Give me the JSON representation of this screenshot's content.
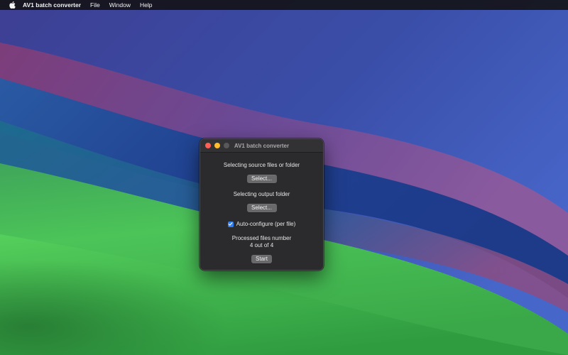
{
  "menubar": {
    "app_name": "AV1 batch converter",
    "items": [
      "File",
      "Window",
      "Help"
    ]
  },
  "window": {
    "title": "AV1 batch converter",
    "source": {
      "label": "Selecting source files or folder",
      "button": "Select..."
    },
    "output": {
      "label": "Selecting output folder",
      "button": "Select..."
    },
    "auto_configure": {
      "label": "Auto-configure (per file)",
      "checked": true
    },
    "processed": {
      "label": "Processed files number",
      "count": "4 out of 4"
    },
    "start_button": "Start"
  },
  "colors": {
    "close": "#ff5f57",
    "minimize": "#febc2e",
    "maximize_disabled": "#58585b",
    "checkbox_accent": "#2f7ff7"
  }
}
